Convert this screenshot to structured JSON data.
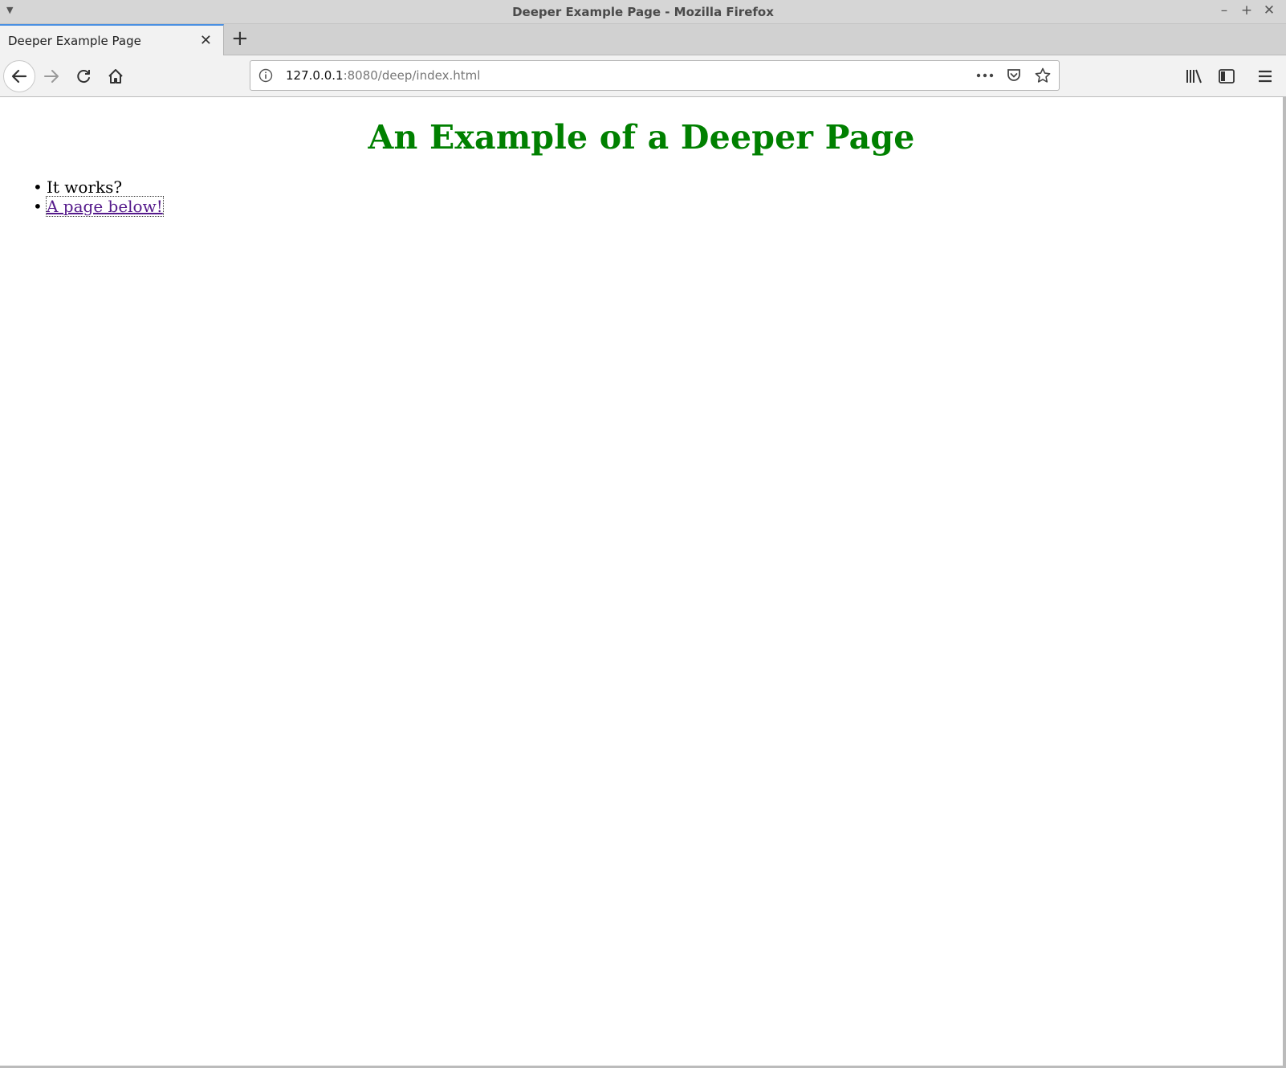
{
  "window": {
    "title": "Deeper Example Page - Mozilla Firefox"
  },
  "tabs": [
    {
      "label": "Deeper Example Page"
    }
  ],
  "urlbar": {
    "host": "127.0.0.1",
    "rest": ":8080/deep/index.html"
  },
  "page": {
    "heading": "An Example of a Deeper Page",
    "items": [
      "It works?",
      "A page below!"
    ]
  },
  "colors": {
    "heading": "#008000",
    "link_visited": "#551a8b",
    "tab_accent": "#4a90e2"
  },
  "icons": [
    "menu-arrow-icon",
    "minimize-icon",
    "maximize-icon",
    "close-icon",
    "tab-close-icon",
    "new-tab-icon",
    "back-icon",
    "forward-icon",
    "reload-icon",
    "home-icon",
    "info-icon",
    "more-icon",
    "pocket-icon",
    "star-icon",
    "library-icon",
    "sidebar-icon",
    "hamburger-menu-icon"
  ]
}
